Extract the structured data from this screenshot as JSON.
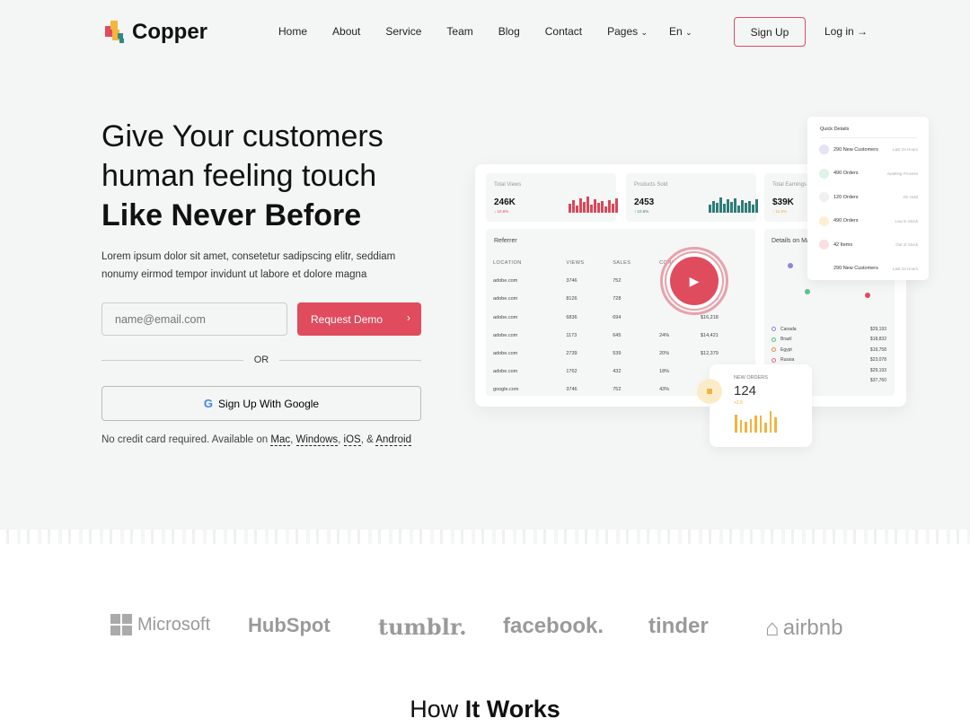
{
  "brand": {
    "name": "Copper",
    "accent": "#e04b5e"
  },
  "nav": {
    "items": [
      "Home",
      "About",
      "Service",
      "Team",
      "Blog",
      "Contact",
      "Pages",
      "En"
    ],
    "signup": "Sign Up",
    "login": "Log in →"
  },
  "hero": {
    "line1": "Give Your customers",
    "line2": "human feeling touch",
    "line3": "Like Never Before",
    "lead": "Lorem ipsum dolor sit amet, consetetur sadipscing elitr, seddiam nonumy eirmod tempor invidunt ut labore et dolore magna",
    "email_placeholder": "name@email.com",
    "demo": "Request Demo",
    "or": "OR",
    "google": "Sign Up With Google",
    "note_prefix": "No credit card required. Available on ",
    "platforms": [
      "Mac",
      "Windows",
      "iOS",
      "Android"
    ],
    "note_and": "& "
  },
  "dashboard": {
    "stats": [
      {
        "label": "Total Views",
        "value": "246K",
        "change": "↓ 10.6%",
        "color": "#d9485a"
      },
      {
        "label": "Products Sold",
        "value": "2453",
        "change": "↑ 10.6%",
        "color": "#2f7d78"
      },
      {
        "label": "Total Earnings",
        "value": "$39K",
        "change": "↑ 11.8%",
        "color": "#f0a830"
      }
    ],
    "referrer": {
      "title": "Referrer",
      "headers": [
        "LOCATION",
        "VIEWS",
        "SALES",
        "CONV",
        "TOTAL"
      ],
      "rows": [
        [
          "adobe.com",
          "3746",
          "752",
          "",
          "$19,291"
        ],
        [
          "adobe.com",
          "8126",
          "728",
          "",
          "$17,638"
        ],
        [
          "adobe.com",
          "6836",
          "694",
          "",
          "$16,218"
        ],
        [
          "adobe.com",
          "1173",
          "645",
          "24%",
          "$14,421"
        ],
        [
          "adobe.com",
          "2739",
          "539",
          "20%",
          "$12,379"
        ],
        [
          "adobe.com",
          "1762",
          "432",
          "18%",
          ""
        ],
        [
          "google.com",
          "3746",
          "752",
          "43%",
          ""
        ]
      ]
    },
    "map": {
      "title": "Details on Map",
      "countries": [
        [
          "Canada",
          "$29,193"
        ],
        [
          "Brazil",
          "$18,832"
        ],
        [
          "Egypt",
          "$19,758"
        ],
        [
          "Russia",
          "$23,078"
        ],
        [
          "",
          "$29,193"
        ],
        [
          "",
          "$37,760"
        ]
      ]
    },
    "quick": {
      "title": "Quick Details",
      "rows": [
        [
          "290 New Customers",
          "Last 24 Hours"
        ],
        [
          "490 Orders",
          "Awaiting Process"
        ],
        [
          "120 Orders",
          "On Hold"
        ],
        [
          "490 Orders",
          "Low in Stock"
        ],
        [
          "42 Items",
          "Out of Stock"
        ],
        [
          "290 New Customers",
          "Last 24 Hours"
        ]
      ]
    },
    "new_orders": {
      "label": "NEW ORDERS",
      "value": "124",
      "change": "+2.8"
    }
  },
  "logos": [
    "Microsoft",
    "HubSpot",
    "tumblr.",
    "facebook.",
    "tinder",
    "airbnb"
  ],
  "how": {
    "pre": "How ",
    "bold": "It Works"
  }
}
